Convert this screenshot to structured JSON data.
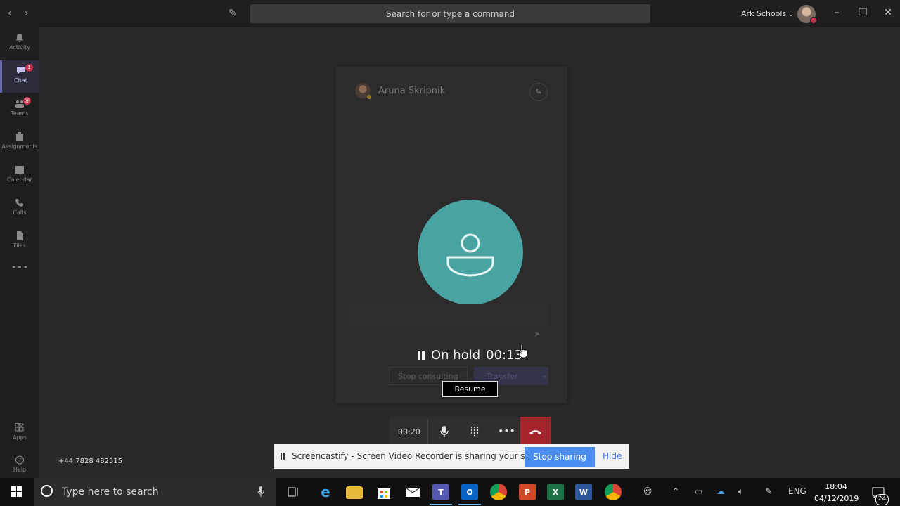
{
  "titlebar": {
    "search_placeholder": "Search for or type a command",
    "org_name": "Ark Schools"
  },
  "rail": {
    "items": [
      {
        "label": "Activity",
        "icon": "bell-icon"
      },
      {
        "label": "Chat",
        "icon": "chat-icon",
        "badge": "1",
        "active": true
      },
      {
        "label": "Teams",
        "icon": "teams-icon",
        "badge": "@"
      },
      {
        "label": "Assignments",
        "icon": "assignments-icon"
      },
      {
        "label": "Calendar",
        "icon": "calendar-icon"
      },
      {
        "label": "Calls",
        "icon": "phone-icon"
      },
      {
        "label": "Files",
        "icon": "file-icon"
      },
      {
        "label": "Apps",
        "icon": "apps-icon"
      },
      {
        "label": "Help",
        "icon": "help-icon"
      }
    ]
  },
  "phone_number": "+44 7828 482515",
  "call": {
    "caller_name": "Aruna Skripnik",
    "status": "On hold",
    "hold_timer": "00:13",
    "stop_consulting_label": "Stop consulting",
    "transfer_label": "Transfer",
    "resume_label": "Resume",
    "avatar_color": "#4aa3a3"
  },
  "controls": {
    "call_timer": "00:20",
    "hangup_color": "#a4262c"
  },
  "share_bar": {
    "message": "Screencastify - Screen Video Recorder is sharing your screen.",
    "stop_label": "Stop sharing",
    "hide_label": "Hide"
  },
  "taskbar": {
    "search_placeholder": "Type here to search",
    "lang": "ENG",
    "time": "18:04",
    "date": "04/12/2019",
    "notification_count": "24"
  }
}
